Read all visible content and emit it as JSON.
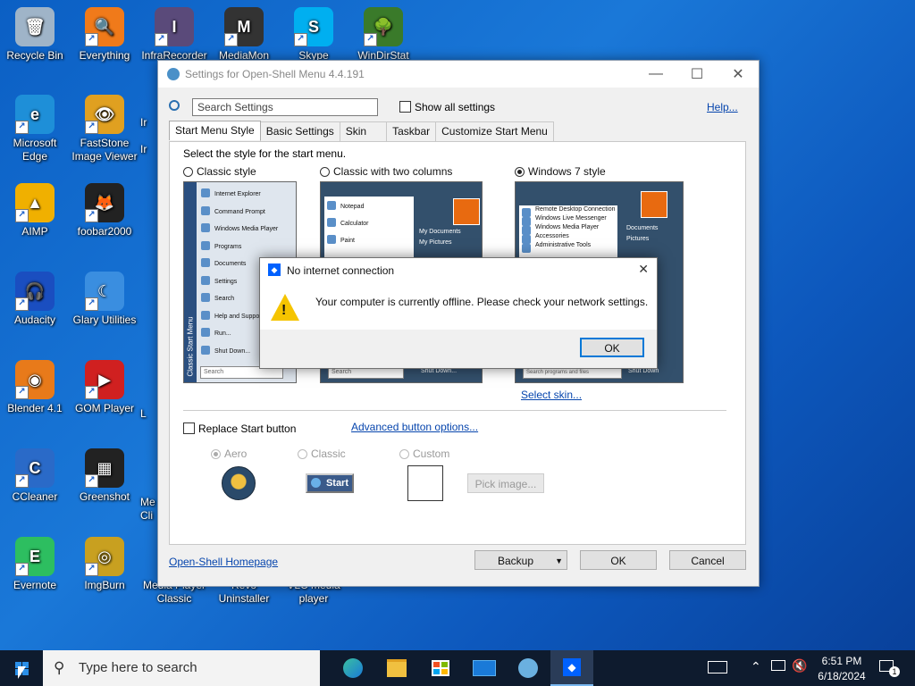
{
  "desktop": {
    "icons": [
      {
        "label": "Recycle Bin",
        "color": "#9fb4c8",
        "glyph": "🗑"
      },
      {
        "label": "Everything",
        "color": "#f07a1a",
        "glyph": "🔍"
      },
      {
        "label": "InfraRecorder",
        "color": "#5a4a7a",
        "glyph": "I"
      },
      {
        "label": "MediaMon",
        "color": "#333333",
        "glyph": "M"
      },
      {
        "label": "Skype",
        "color": "#00aff0",
        "glyph": "S"
      },
      {
        "label": "WinDirStat",
        "color": "#3a7a2a",
        "glyph": "🌳"
      },
      {
        "label": "Microsoft Edge",
        "color": "#1e8fd8",
        "glyph": "e"
      },
      {
        "label": "FastStone Image Viewer",
        "color": "#e0a020",
        "glyph": "👁"
      },
      {
        "label": "AIMP",
        "color": "#f0b000",
        "glyph": "▲"
      },
      {
        "label": "foobar2000",
        "color": "#222222",
        "glyph": "🦊"
      },
      {
        "label": "Audacity",
        "color": "#1a4ec0",
        "glyph": "🎧"
      },
      {
        "label": "Glary Utilities",
        "color": "#3a8ee0",
        "glyph": "☾"
      },
      {
        "label": "Blender 4.1",
        "color": "#e87a1a",
        "glyph": "◉"
      },
      {
        "label": "GOM Player",
        "color": "#d02020",
        "glyph": "▶"
      },
      {
        "label": "CCleaner",
        "color": "#2a6ac8",
        "glyph": "C"
      },
      {
        "label": "Greenshot",
        "color": "#222222",
        "glyph": "▦"
      },
      {
        "label": "Evernote",
        "color": "#2dbe60",
        "glyph": "E"
      },
      {
        "label": "ImgBurn",
        "color": "#c8a020",
        "glyph": "◎"
      },
      {
        "label": "Media Player Classic",
        "color": "",
        "glyph": ""
      },
      {
        "label": "Revo Uninstaller",
        "color": "",
        "glyph": ""
      },
      {
        "label": "VLC media player",
        "color": "",
        "glyph": ""
      }
    ],
    "partial_left_labels": [
      "Ir",
      "Ir",
      "L",
      "Me Cli"
    ]
  },
  "window": {
    "title": "Settings for Open-Shell Menu 4.4.191",
    "search_placeholder": "Search Settings",
    "show_all_settings": "Show all settings",
    "help_link": "Help...",
    "tabs": [
      "Start Menu Style",
      "Basic Settings",
      "Skin",
      "Taskbar",
      "Customize Start Menu"
    ],
    "active_tab": "Start Menu Style",
    "select_style_text": "Select the style for the start menu.",
    "styles": [
      {
        "label": "Classic style",
        "selected": false
      },
      {
        "label": "Classic with two columns",
        "selected": false
      },
      {
        "label": "Windows 7 style",
        "selected": true
      }
    ],
    "classic_preview_items": [
      "Internet Explorer",
      "Command Prompt",
      "Windows Media Player",
      "Programs",
      "Documents",
      "Settings",
      "Search",
      "Help and Support",
      "Run...",
      "Shut Down..."
    ],
    "classic_sidebar_text": "Classic Start Menu",
    "classic_search": "Search",
    "two_col_items": [
      "Notepad",
      "Calculator",
      "Paint"
    ],
    "two_col_right": [
      "My Documents",
      "My Pictures"
    ],
    "two_col_search": "Search",
    "two_col_shutdown": "Shut Down...",
    "win7_items": [
      "Remote Desktop Connection",
      "Windows Live Messenger",
      "Windows Media Player",
      "Accessories",
      "Administrative Tools"
    ],
    "win7_right": [
      "Documents",
      "Pictures"
    ],
    "win7_search": "Search programs and files",
    "win7_shutdown": "Shut Down",
    "select_skin_link": "Select skin...",
    "replace_start": "Replace Start button",
    "advanced_button_link": "Advanced button options...",
    "button_styles": [
      {
        "label": "Aero",
        "selected": true
      },
      {
        "label": "Classic",
        "selected": false
      },
      {
        "label": "Custom",
        "selected": false
      }
    ],
    "classic_start_label": "Start",
    "pick_image": "Pick image...",
    "homepage_link": "Open-Shell Homepage",
    "backup": "Backup",
    "ok": "OK",
    "cancel": "Cancel"
  },
  "dialog": {
    "title": "No internet connection",
    "message": "Your computer is currently offline. Please check your network settings.",
    "ok": "OK"
  },
  "taskbar": {
    "search_placeholder": "Type here to search",
    "time": "6:51 PM",
    "date": "6/18/2024",
    "notification_count": "1"
  }
}
